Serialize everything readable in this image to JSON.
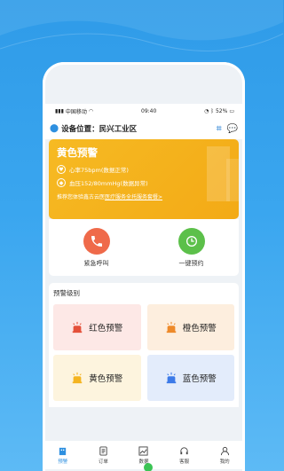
{
  "status": {
    "carrier": "中国移动",
    "time": "09:40",
    "battery": "52%"
  },
  "location": {
    "label": "设备位置：",
    "value": "民兴工业区"
  },
  "alert": {
    "title": "黄色预警",
    "heart": "心率75bpm(数据正常)",
    "bp": "血压152/80mmHg(数据异常)",
    "rec_prefix": "推荐您体验鑫古云医",
    "rec_link": "医疗服务全托服务套餐>"
  },
  "actions": [
    {
      "label": "紧急呼叫",
      "icon": "phone-icon",
      "color": "#ef6a4a"
    },
    {
      "label": "一键预约",
      "icon": "clock-icon",
      "color": "#5cc04a"
    }
  ],
  "levels": {
    "title": "预警级别",
    "items": [
      {
        "label": "红色预警",
        "color": "#e4503a"
      },
      {
        "label": "橙色预警",
        "color": "#ee8a2a"
      },
      {
        "label": "黄色预警",
        "color": "#f4b421"
      },
      {
        "label": "蓝色预警",
        "color": "#3c7ae8"
      }
    ]
  },
  "tabs": [
    {
      "label": "预警",
      "icon": "building-icon"
    },
    {
      "label": "订单",
      "icon": "document-icon"
    },
    {
      "label": "数据",
      "icon": "chart-icon"
    },
    {
      "label": "客服",
      "icon": "headset-icon"
    },
    {
      "label": "我的",
      "icon": "user-icon"
    }
  ]
}
